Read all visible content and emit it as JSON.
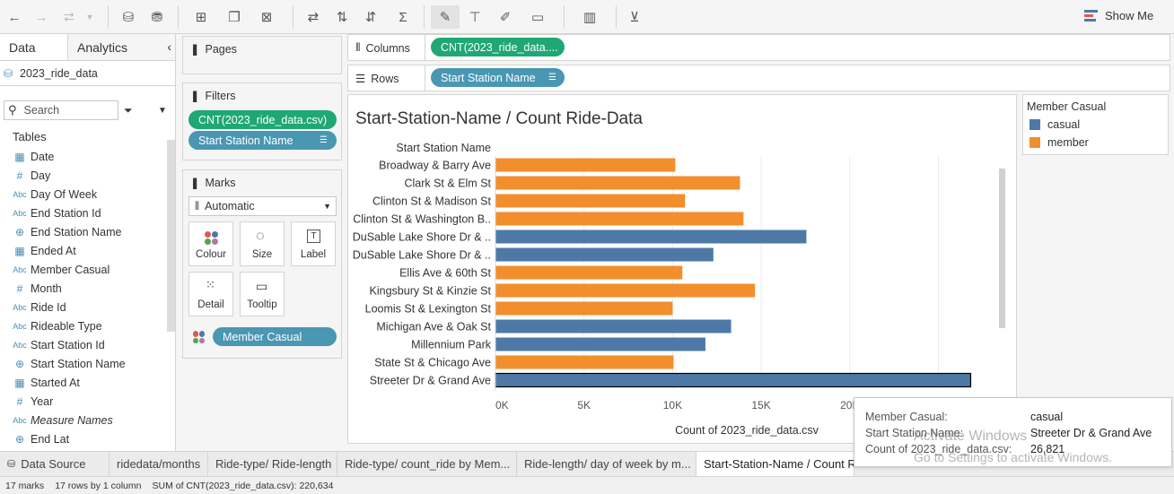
{
  "toolbar": {
    "show_me": "Show Me"
  },
  "left_pane": {
    "tabs": [
      "Data",
      "Analytics"
    ],
    "datasource": "2023_ride_data",
    "search_placeholder": "Search",
    "tables_label": "Tables",
    "fields": [
      {
        "icon": "calendar",
        "glyph": "▦",
        "name": "Date"
      },
      {
        "icon": "number",
        "glyph": "#",
        "name": "Day"
      },
      {
        "icon": "text",
        "glyph": "Abc",
        "name": "Day Of Week"
      },
      {
        "icon": "text",
        "glyph": "Abc",
        "name": "End Station Id"
      },
      {
        "icon": "globe",
        "glyph": "⊕",
        "name": "End Station Name"
      },
      {
        "icon": "calendar",
        "glyph": "▦",
        "name": "Ended At"
      },
      {
        "icon": "text",
        "glyph": "Abc",
        "name": "Member Casual"
      },
      {
        "icon": "number",
        "glyph": "#",
        "name": "Month"
      },
      {
        "icon": "text",
        "glyph": "Abc",
        "name": "Ride Id"
      },
      {
        "icon": "text",
        "glyph": "Abc",
        "name": "Rideable Type"
      },
      {
        "icon": "text",
        "glyph": "Abc",
        "name": "Start Station Id"
      },
      {
        "icon": "globe",
        "glyph": "⊕",
        "name": "Start Station Name"
      },
      {
        "icon": "calendar",
        "glyph": "▦",
        "name": "Started At"
      },
      {
        "icon": "number",
        "glyph": "#",
        "name": "Year"
      },
      {
        "icon": "text",
        "glyph": "Abc",
        "name": "Measure Names"
      },
      {
        "icon": "globe",
        "glyph": "⊕",
        "name": "End Lat"
      }
    ]
  },
  "pages": {
    "title": "Pages"
  },
  "filters": {
    "title": "Filters",
    "items": [
      "CNT(2023_ride_data.csv)",
      "Start Station Name"
    ]
  },
  "marks": {
    "title": "Marks",
    "type": "Automatic",
    "buttons": [
      "Colour",
      "Size",
      "Label",
      "Detail",
      "Tooltip"
    ],
    "color_pill": "Member Casual"
  },
  "shelves": {
    "columns_label": "Columns",
    "columns_pill": "CNT(2023_ride_data....",
    "rows_label": "Rows",
    "rows_pill": "Start Station Name"
  },
  "legend": {
    "title": "Member Casual",
    "items": [
      {
        "name": "casual",
        "color": "#4e79a7"
      },
      {
        "name": "member",
        "color": "#f28e2b"
      }
    ]
  },
  "chart_data": {
    "type": "bar",
    "title": "Start-Station-Name / Count Ride-Data",
    "row_header": "Start Station Name",
    "xlabel": "Count of 2023_ride_data.csv",
    "xlim": [
      0,
      27000
    ],
    "ticks": [
      "0K",
      "5K",
      "10K",
      "15K",
      "20K"
    ],
    "categories": [
      "Broadway & Barry Ave",
      "Clark St & Elm St",
      "Clinton St & Madison St",
      "Clinton St & Washington B..",
      "DuSable Lake Shore Dr & ..",
      "DuSable Lake Shore Dr & ..",
      "Ellis Ave & 60th St",
      "Kingsbury St & Kinzie St",
      "Loomis St & Lexington St",
      "Michigan Ave & Oak St",
      "Millennium Park",
      "State St & Chicago Ave",
      "Streeter Dr & Grand Ave"
    ],
    "values": [
      10150,
      13800,
      10700,
      14000,
      17550,
      12300,
      10550,
      14650,
      10000,
      13300,
      11850,
      10050,
      26821
    ],
    "series_of_bar": [
      "member",
      "member",
      "member",
      "member",
      "casual",
      "casual",
      "member",
      "member",
      "member",
      "casual",
      "casual",
      "member",
      "casual"
    ]
  },
  "sheet_tabs": [
    "Data Source",
    "ridedata/months",
    "Ride-type/ Ride-length",
    "Ride-type/ count_ride by Mem...",
    "Ride-length/ day of week by m...",
    "Start-Station-Name / Count R"
  ],
  "status": {
    "marks": "17 marks",
    "rows": "17 rows by 1 column",
    "sum": "SUM of CNT(2023_ride_data.csv): 220,634"
  },
  "tooltip": {
    "rows": [
      {
        "label": "Member Casual:",
        "value": "casual"
      },
      {
        "label": "Start Station Name:",
        "value": "Streeter Dr & Grand Ave"
      },
      {
        "label": "Count of 2023_ride_data.csv:",
        "value": "26,821"
      }
    ]
  },
  "watermark": {
    "line1": "Activate Windows",
    "line2": "Go to Settings to activate Windows."
  }
}
